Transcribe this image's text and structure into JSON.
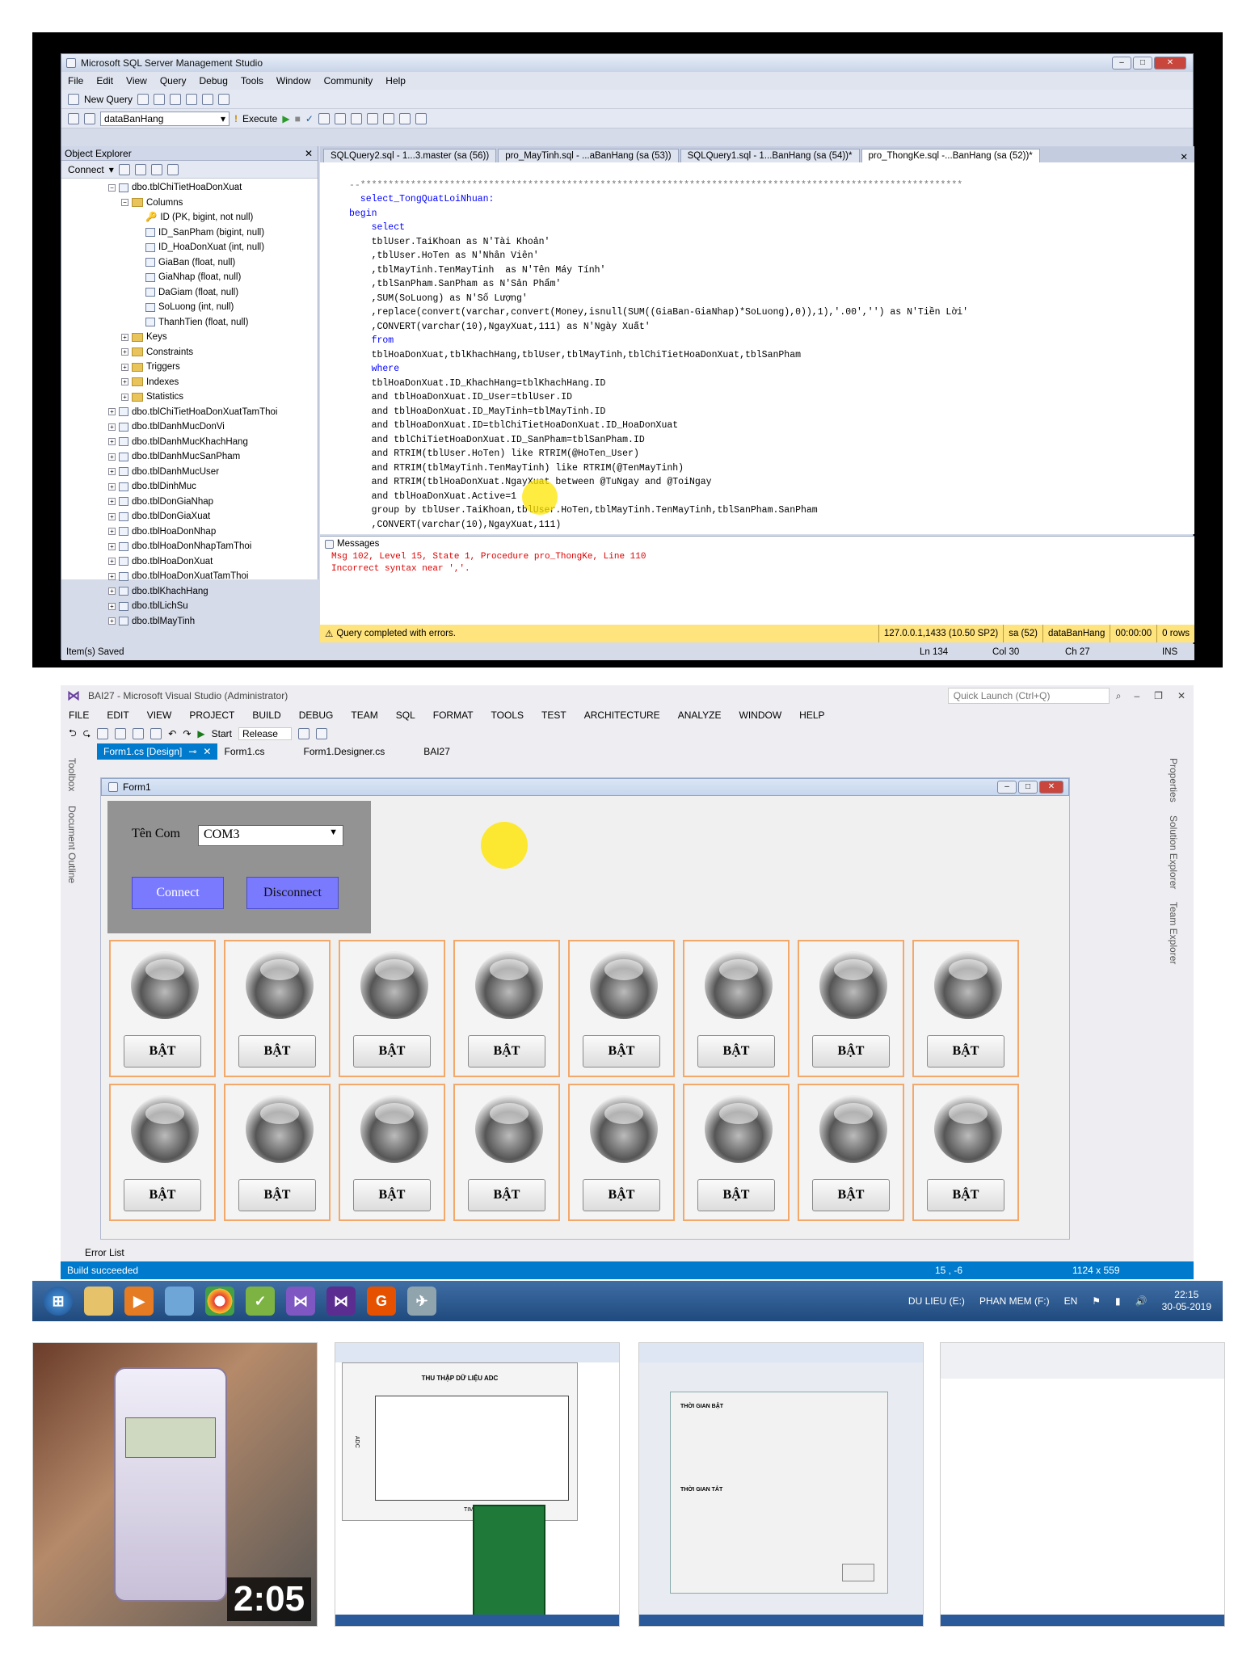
{
  "ssms": {
    "title": "Microsoft SQL Server Management Studio",
    "menu": [
      "File",
      "Edit",
      "View",
      "Query",
      "Debug",
      "Tools",
      "Window",
      "Community",
      "Help"
    ],
    "new_query": "New Query",
    "database": "dataBanHang",
    "execute": "Execute",
    "object_explorer": "Object Explorer",
    "connect": "Connect",
    "tree": {
      "table": "dbo.tblChiTietHoaDonXuat",
      "columns_folder": "Columns",
      "columns": [
        "ID (PK, bigint, not null)",
        "ID_SanPham (bigint, null)",
        "ID_HoaDonXuat (int, null)",
        "GiaBan (float, null)",
        "GiaNhap (float, null)",
        "DaGiam (float, null)",
        "SoLuong (int, null)",
        "ThanhTien (float, null)"
      ],
      "folders": [
        "Keys",
        "Constraints",
        "Triggers",
        "Indexes",
        "Statistics"
      ],
      "tables": [
        "dbo.tblChiTietHoaDonXuatTamThoi",
        "dbo.tblDanhMucDonVi",
        "dbo.tblDanhMucKhachHang",
        "dbo.tblDanhMucSanPham",
        "dbo.tblDanhMucUser",
        "dbo.tblDinhMuc",
        "dbo.tblDonGiaNhap",
        "dbo.tblDonGiaXuat",
        "dbo.tblHoaDonNhap",
        "dbo.tblHoaDonNhapTamThoi",
        "dbo.tblHoaDonXuat",
        "dbo.tblHoaDonXuatTamThoi",
        "dbo.tblKhachHang",
        "dbo.tblLichSu",
        "dbo.tblMayTinh"
      ]
    },
    "tabs": [
      "SQLQuery2.sql - 1...3.master (sa (56))",
      "pro_MayTinh.sql - ...aBanHang (sa (53))",
      "SQLQuery1.sql - 1...BanHang (sa (54))*",
      "pro_ThongKe.sql -...BanHang (sa (52))*"
    ],
    "code": [
      "--************************************************************************************************************",
      "  select_TongQuatLoiNhuan:",
      "begin",
      "    select",
      "    tblUser.TaiKhoan as N'Tài Khoản'",
      "    ,tblUser.HoTen as N'Nhân Viên'",
      "    ,tblMayTinh.TenMayTinh  as N'Tên Máy Tính'",
      "    ,tblSanPham.SanPham as N'Sản Phẩm'",
      "    ,SUM(SoLuong) as N'Số Lượng'",
      "    ,replace(convert(varchar,convert(Money,isnull(SUM((GiaBan-GiaNhap)*SoLuong),0)),1),'.00','') as N'Tiền Lời'",
      "    ,CONVERT(varchar(10),NgayXuat,111) as N'Ngày Xuất'",
      "    from",
      "    tblHoaDonXuat,tblKhachHang,tblUser,tblMayTinh,tblChiTietHoaDonXuat,tblSanPham",
      "    where",
      "    tblHoaDonXuat.ID_KhachHang=tblKhachHang.ID",
      "    and tblHoaDonXuat.ID_User=tblUser.ID",
      "    and tblHoaDonXuat.ID_MayTinh=tblMayTinh.ID",
      "    and tblHoaDonXuat.ID=tblChiTietHoaDonXuat.ID_HoaDonXuat",
      "    and tblChiTietHoaDonXuat.ID_SanPham=tblSanPham.ID",
      "    and RTRIM(tblUser.HoTen) like RTRIM(@HoTen_User)",
      "    and RTRIM(tblMayTinh.TenMayTinh) like RTRIM(@TenMayTinh)",
      "    and RTRIM(tblHoaDonXuat.NgayXuat between @TuNgay and @ToiNgay",
      "    and tblHoaDonXuat.Active=1",
      "    group by tblUser.TaiKhoan,tblUser.HoTen,tblMayTinh.TenMayTinh,tblSanPham.SanPham",
      "    ,CONVERT(varchar(10),NgayXuat,111)"
    ],
    "messages_tab": "Messages",
    "messages": [
      "Msg 102, Level 15, State 1, Procedure pro_ThongKe, Line 110",
      "Incorrect syntax near ','."
    ],
    "status": {
      "text": "Query completed with errors.",
      "server": "127.0.0.1,1433 (10.50 SP2)",
      "user": "sa (52)",
      "db": "dataBanHang",
      "time": "00:00:00",
      "rows": "0 rows"
    },
    "bottom": {
      "left": "Item(s) Saved",
      "ln": "Ln 134",
      "col": "Col 30",
      "ch": "Ch 27",
      "ins": "INS"
    }
  },
  "vs": {
    "title": "BAI27 - Microsoft Visual Studio (Administrator)",
    "quick_launch": "Quick Launch (Ctrl+Q)",
    "menu": [
      "FILE",
      "EDIT",
      "VIEW",
      "PROJECT",
      "BUILD",
      "DEBUG",
      "TEAM",
      "SQL",
      "FORMAT",
      "TOOLS",
      "TEST",
      "ARCHITECTURE",
      "ANALYZE",
      "WINDOW",
      "HELP"
    ],
    "start": "Start",
    "config": "Release",
    "tabs": [
      "Form1.cs [Design]",
      "Form1.cs",
      "Form1.Designer.cs",
      "BAI27"
    ],
    "side_left": [
      "Toolbox",
      "Document Outline"
    ],
    "side_right": [
      "Properties",
      "Solution Explorer",
      "Team Explorer"
    ],
    "form_title": "Form1",
    "ten_com_label": "Tên Com",
    "com_value": "COM3",
    "connect_btn": "Connect",
    "disconnect_btn": "Disconnect",
    "led_button": "BẬT",
    "error_list": "Error List",
    "build_status": "Build succeeded",
    "pos": "15 , -6",
    "size": "1124 x 559"
  },
  "taskbar": {
    "drive1": "DU LIEU (E:)",
    "drive2": "PHAN MEM (F:)",
    "lang": "EN",
    "time": "22:15",
    "date": "30-05-2019"
  },
  "thumbs": {
    "duration": "2:05",
    "adc_title": "THU THẬP DỮ LIỆU ADC",
    "time_label": "TIME",
    "adc_label": "ADC",
    "start_section": "THỜI GIAN BẬT",
    "end_section": "THỜI GIAN TẮT"
  }
}
